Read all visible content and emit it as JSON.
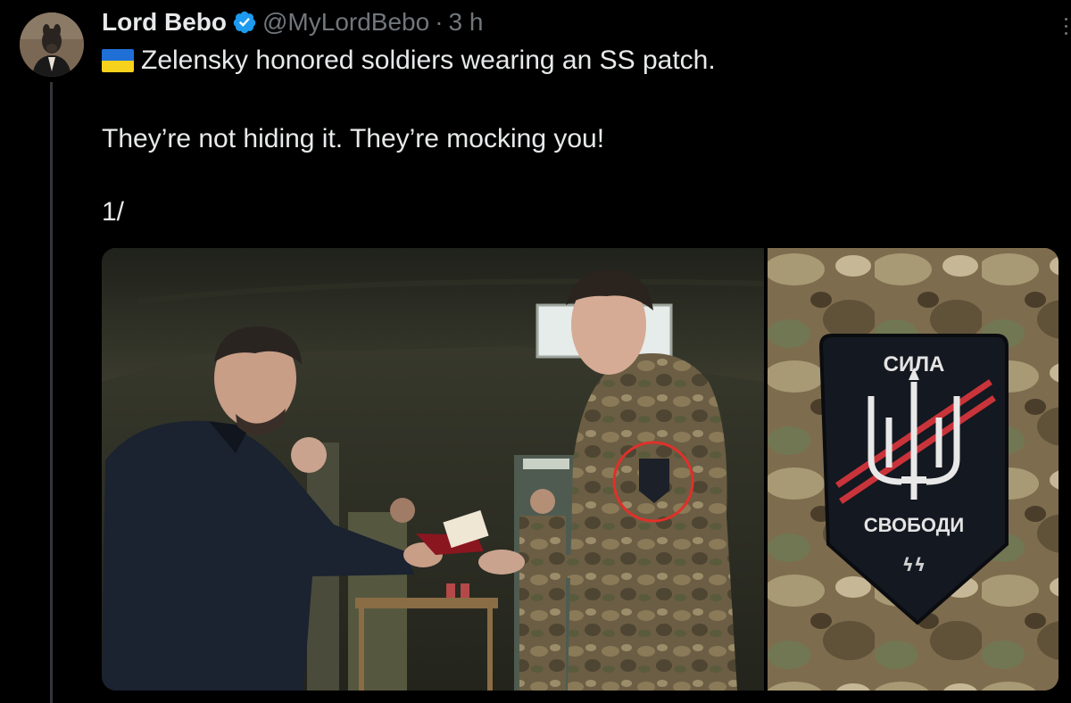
{
  "tweet": {
    "author_name": "Lord Bebo",
    "verified_icon": "verified-badge-icon",
    "handle": "@MyLordBebo",
    "separator": "·",
    "time": "3 h",
    "flag_icon": "ukraine-flag-icon",
    "text_line1": "Zelensky honored soldiers wearing an SS patch.",
    "text_line2": "They’re not hiding it. They’re mocking you!",
    "text_line3": "1/"
  },
  "media": {
    "patch": {
      "top_text": "СИЛА",
      "bottom_text": "СВОБОДИ",
      "mark": "ϟϟ"
    }
  },
  "colors": {
    "background": "#000000",
    "text": "#e7e9ea",
    "secondary_text": "#71767b",
    "verified": "#1d9bf0",
    "annotation_circle": "#e0302a"
  }
}
